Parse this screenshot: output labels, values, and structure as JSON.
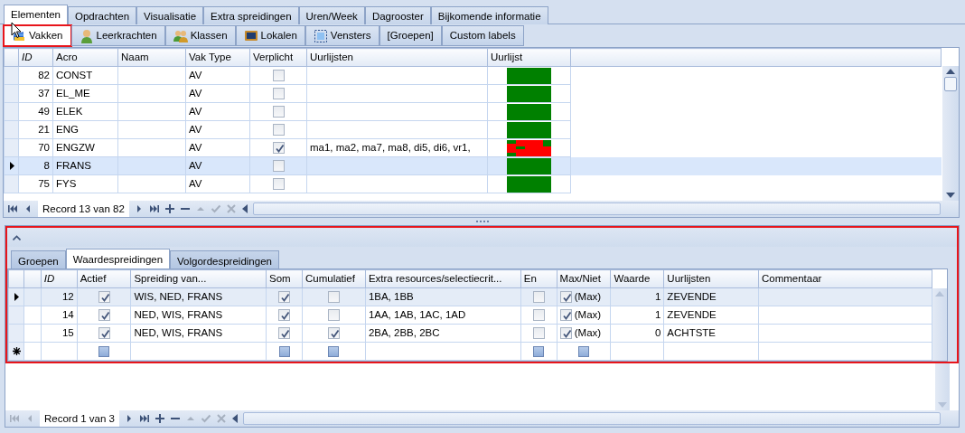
{
  "main_tabs": [
    {
      "label": "Elementen",
      "selected": true
    },
    {
      "label": "Opdrachten",
      "selected": false
    },
    {
      "label": "Visualisatie",
      "selected": false
    },
    {
      "label": "Extra spreidingen",
      "selected": false
    },
    {
      "label": "Uren/Week",
      "selected": false
    },
    {
      "label": "Dagrooster",
      "selected": false
    },
    {
      "label": "Bijkomende informatie",
      "selected": false
    }
  ],
  "element_tabs": [
    {
      "label": "Vakken",
      "kind": "book",
      "selected": true,
      "highlighted": true
    },
    {
      "label": "Leerkrachten",
      "kind": "person",
      "selected": false,
      "highlighted": false
    },
    {
      "label": "Klassen",
      "kind": "people",
      "selected": false,
      "highlighted": false
    },
    {
      "label": "Lokalen",
      "kind": "monitor",
      "selected": false,
      "highlighted": false
    },
    {
      "label": "Vensters",
      "kind": "frame",
      "selected": false,
      "highlighted": false
    },
    {
      "label": "[Groepen]",
      "selected": false,
      "highlighted": false
    },
    {
      "label": "Custom labels",
      "selected": false,
      "highlighted": false
    }
  ],
  "subjects_grid": {
    "columns": [
      "ID",
      "Acro",
      "Naam",
      "Vak Type",
      "Verplicht",
      "Uurlijsten",
      "Uurlijst"
    ],
    "rows": [
      {
        "id": "82",
        "acro": "CONST",
        "vak_type": "AV",
        "verplicht": false,
        "uurlijst_conflict": false,
        "selected": false
      },
      {
        "id": "37",
        "acro": "EL_ME",
        "vak_type": "AV",
        "verplicht": false,
        "uurlijst_conflict": false,
        "selected": false
      },
      {
        "id": "49",
        "acro": "ELEK",
        "vak_type": "AV",
        "verplicht": false,
        "uurlijst_conflict": false,
        "selected": false
      },
      {
        "id": "21",
        "acro": "ENG",
        "vak_type": "AV",
        "verplicht": false,
        "uurlijst_conflict": false,
        "selected": false
      },
      {
        "id": "70",
        "acro": "ENGZW",
        "vak_type": "AV",
        "verplicht": true,
        "uurlijsten": "ma1, ma2, ma7, ma8, di5, di6, vr1,",
        "uurlijst_conflict": true,
        "selected": false
      },
      {
        "id": "8",
        "acro": "FRANS",
        "vak_type": "AV",
        "verplicht": false,
        "uurlijst_conflict": false,
        "selected": true
      },
      {
        "id": "75",
        "acro": "FYS",
        "vak_type": "AV",
        "verplicht": false,
        "uurlijst_conflict": false,
        "selected": false
      }
    ],
    "navigator": {
      "record": "Record 13 van 82",
      "buttons_left": [
        {
          "kind": "first",
          "disabled": false
        },
        {
          "kind": "prev",
          "disabled": false
        }
      ],
      "buttons_right": [
        {
          "kind": "next",
          "disabled": false
        },
        {
          "kind": "last",
          "disabled": false
        },
        {
          "kind": "add",
          "disabled": false
        },
        {
          "kind": "remove",
          "disabled": false
        },
        {
          "kind": "up",
          "disabled": true
        },
        {
          "kind": "save",
          "disabled": true
        },
        {
          "kind": "cancel",
          "disabled": true
        }
      ]
    }
  },
  "detail_panel": {
    "highlighted": true,
    "tabs": [
      {
        "label": "Groepen",
        "selected": false
      },
      {
        "label": "Waardespreidingen",
        "selected": true
      },
      {
        "label": "Volgordespreidingen",
        "selected": false
      }
    ],
    "columns": [
      "ID",
      "Actief",
      "Spreiding van...",
      "Som",
      "Cumulatief",
      "Extra resources/selectiecrit...",
      "En",
      "Max/Niet",
      "Waarde",
      "Uurlijsten",
      "Commentaar"
    ],
    "rows": [
      {
        "kind": "data",
        "selected": true,
        "id": "12",
        "actief": true,
        "spreiding": "WIS, NED, FRANS",
        "som": true,
        "cumulatief": false,
        "extra": "1BA, 1BB",
        "en": false,
        "max_niet": true,
        "max_label": "(Max)",
        "waarde": "1",
        "uurlijsten": "ZEVENDE"
      },
      {
        "kind": "data",
        "selected": false,
        "id": "14",
        "actief": true,
        "spreiding": "NED, WIS, FRANS",
        "som": true,
        "cumulatief": false,
        "extra": "1AA, 1AB, 1AC, 1AD",
        "en": false,
        "max_niet": true,
        "max_label": "(Max)",
        "waarde": "1",
        "uurlijsten": "ZEVENDE"
      },
      {
        "kind": "data",
        "selected": false,
        "id": "15",
        "actief": true,
        "spreiding": "NED, WIS, FRANS",
        "som": true,
        "cumulatief": true,
        "extra": "2BA, 2BB, 2BC",
        "en": false,
        "max_niet": true,
        "max_label": "(Max)",
        "waarde": "0",
        "uurlijsten": "ACHTSTE"
      },
      {
        "kind": "new",
        "selected": false
      }
    ],
    "navigator": {
      "record": "Record 1 van 3",
      "buttons_left": [
        {
          "kind": "first",
          "disabled": true
        },
        {
          "kind": "prev",
          "disabled": true
        }
      ],
      "buttons_right": [
        {
          "kind": "next",
          "disabled": false
        },
        {
          "kind": "last",
          "disabled": false
        },
        {
          "kind": "add",
          "disabled": false
        },
        {
          "kind": "remove",
          "disabled": false
        },
        {
          "kind": "up",
          "disabled": true
        },
        {
          "kind": "save",
          "disabled": true
        },
        {
          "kind": "cancel",
          "disabled": true
        }
      ]
    }
  }
}
